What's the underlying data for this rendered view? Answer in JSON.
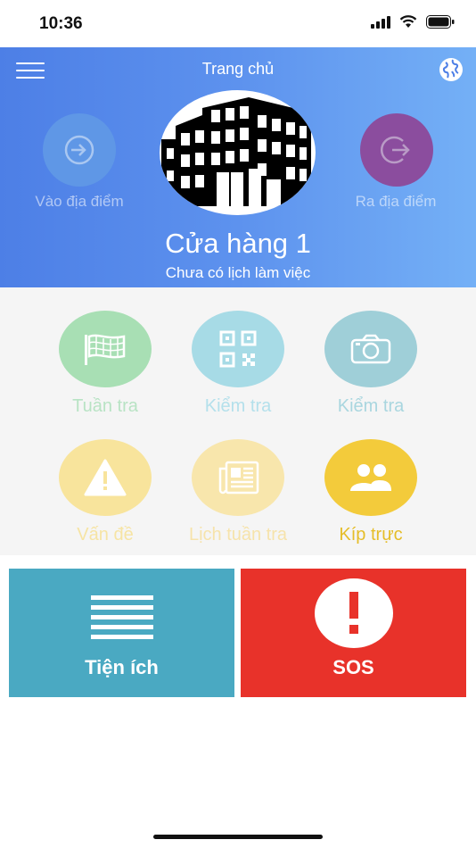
{
  "status_bar": {
    "time": "10:36"
  },
  "header": {
    "title": "Trang chủ",
    "check_in_label": "Vào địa điểm",
    "check_out_label": "Ra địa điểm",
    "store_name": "Cửa hàng 1",
    "schedule_status": "Chưa có lịch làm việc"
  },
  "grid": {
    "items": [
      {
        "label": "Tuần tra",
        "icon": "flag-icon",
        "color": "#a8dfb4",
        "text_color": "#b8e3c4"
      },
      {
        "label": "Kiểm tra",
        "icon": "qr-code-icon",
        "color": "#a7dbe6",
        "text_color": "#b4e0eb"
      },
      {
        "label": "Kiểm tra",
        "icon": "camera-icon",
        "color": "#9fcfd8",
        "text_color": "#a9d6df"
      },
      {
        "label": "Vấn đề",
        "icon": "warning-icon",
        "color": "#f8e49c",
        "text_color": "#f6e4a4"
      },
      {
        "label": "Lịch tuần tra",
        "icon": "newspaper-icon",
        "color": "#f8e6ac",
        "text_color": "#f6e3ab"
      },
      {
        "label": "Kíp trực",
        "icon": "users-icon",
        "color": "#f3cb3b",
        "text_color": "#e5bd28"
      }
    ]
  },
  "tiles": {
    "utilities_label": "Tiện ích",
    "sos_label": "SOS"
  },
  "colors": {
    "header_start": "#4d7fe6",
    "header_end": "#74b0f6",
    "utilities": "#4aa9c2",
    "sos": "#e8322a"
  }
}
